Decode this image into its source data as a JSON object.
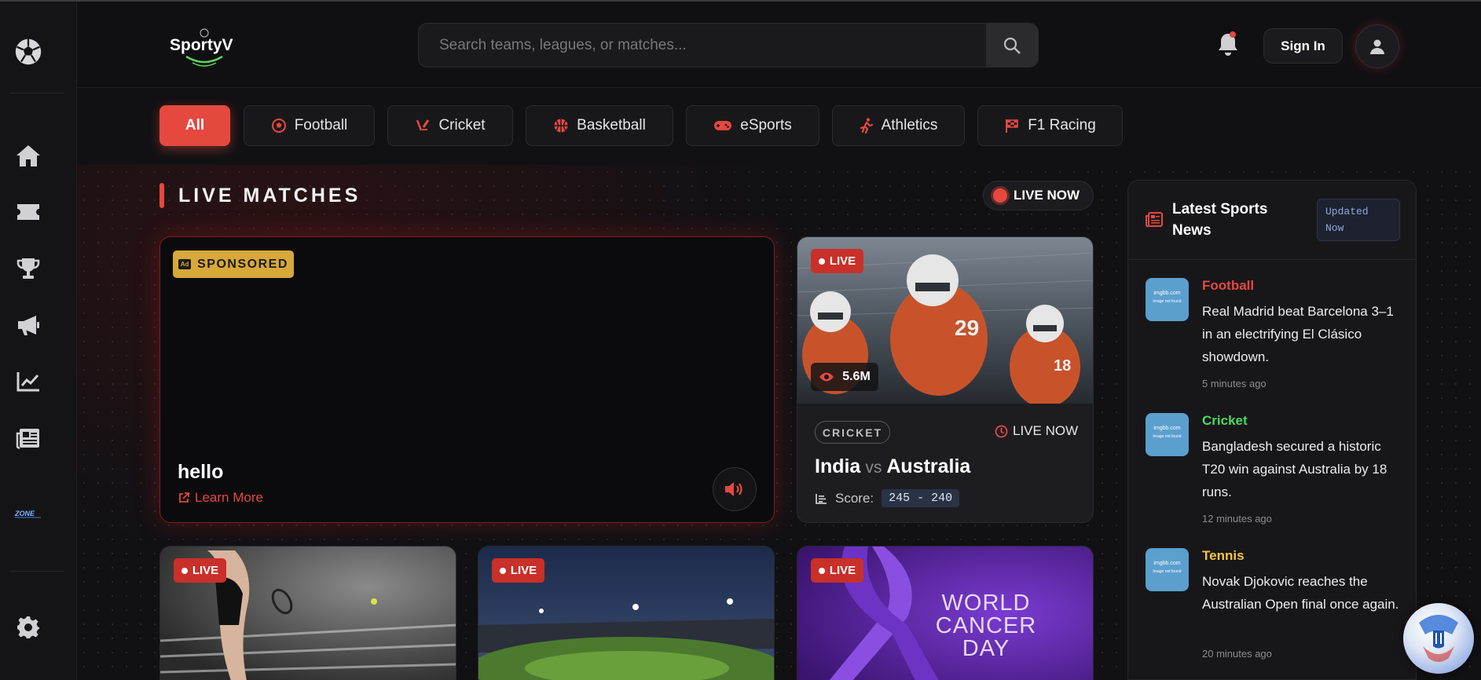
{
  "header": {
    "logo_text": "SportyV",
    "search_placeholder": "Search teams, leagues, or matches...",
    "signin_label": "Sign In"
  },
  "sidebar": {
    "items": [
      {
        "icon": "soccer-ball-icon"
      },
      {
        "icon": "home-icon"
      },
      {
        "icon": "ticket-icon"
      },
      {
        "icon": "trophy-icon"
      },
      {
        "icon": "megaphone-icon"
      },
      {
        "icon": "chart-line-icon"
      },
      {
        "icon": "newspaper-icon"
      },
      {
        "icon": "zone-logo-icon",
        "label": "ZONE"
      },
      {
        "icon": "gear-icon"
      }
    ]
  },
  "filters": [
    {
      "label": "All",
      "active": true
    },
    {
      "label": "Football",
      "icon": "football-icon"
    },
    {
      "label": "Cricket",
      "icon": "cricket-icon"
    },
    {
      "label": "Basketball",
      "icon": "basketball-icon"
    },
    {
      "label": "eSports",
      "icon": "gamepad-icon"
    },
    {
      "label": "Athletics",
      "icon": "runner-icon"
    },
    {
      "label": "F1 Racing",
      "icon": "flag-checkered-icon"
    }
  ],
  "live_section": {
    "title": "LIVE MATCHES",
    "live_now_label": "LIVE NOW"
  },
  "sponsored": {
    "badge": "SPONSORED",
    "ad_icon_text": "Ad",
    "headline": "hello",
    "link": "Learn More"
  },
  "match_card": {
    "live_label": "LIVE",
    "viewers": "5.6M",
    "sport": "CRICKET",
    "status": "LIVE NOW",
    "team_home": "India",
    "vs": "vs",
    "team_away": "Australia",
    "score_label": "Score:",
    "score": "245 - 240"
  },
  "bottom_cards": [
    {
      "live_label": "LIVE"
    },
    {
      "live_label": "LIVE"
    },
    {
      "live_label": "LIVE",
      "image_text": [
        "WORLD",
        "CANCER",
        "DAY"
      ]
    }
  ],
  "news": {
    "title": "Latest Sports News",
    "updated_badge": "Updated Now",
    "thumb_text": "imgbb.com",
    "thumb_sub": "Image not found",
    "items": [
      {
        "category": "Football",
        "color": "#e5483f",
        "text": "Real Madrid beat Barcelona 3–1 in an electrifying El Clásico showdown.",
        "time": "5 minutes ago"
      },
      {
        "category": "Cricket",
        "color": "#4cd964",
        "text": "Bangladesh secured a historic T20 win against Australia by 18 runs.",
        "time": "12 minutes ago"
      },
      {
        "category": "Tennis",
        "color": "#f5c542",
        "text": "Novak Djokovic reaches the Australian Open final once again.",
        "time": "20 minutes ago"
      }
    ]
  },
  "colors": {
    "accent": "#e5483f",
    "background": "#111114",
    "sponsored_badge": "#d7a83a"
  }
}
